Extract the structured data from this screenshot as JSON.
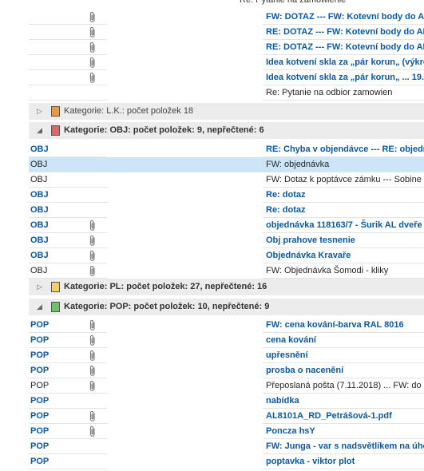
{
  "top_fragment": "Re: Pytanie na zamowienie",
  "top_rows": [
    {
      "subject": "FW: DOTAZ --- FW: Kotevní body do AL",
      "attach": true,
      "unread": true
    },
    {
      "subject": "RE: DOTAZ --- FW: Kotevní body do AL",
      "attach": true,
      "unread": true
    },
    {
      "subject": "RE: DOTAZ --- FW: Kotevní body do AL",
      "attach": true,
      "unread": true
    },
    {
      "subject": "Idea kotvení skla za „pár korun„ (výkre",
      "attach": true,
      "unread": true
    },
    {
      "subject": "Idea kotvení skla za „pár korun„ ... 19.",
      "attach": true,
      "unread": true
    },
    {
      "subject": "Re: Pytanie na odbior zamowien",
      "attach": false,
      "unread": false
    }
  ],
  "groups": {
    "lk": {
      "label": "Kategorie: L.K.: počet položek 18",
      "color": "#f0963c",
      "expanded": false
    },
    "obj": {
      "label": "Kategorie: OBJ: počet položek: 9, nepřečtené: 6",
      "color": "#e06666",
      "expanded": true
    },
    "pl": {
      "label": "Kategorie: PL: počet položek: 27, nepřečtené: 16",
      "color": "#f5d15a",
      "expanded": false
    },
    "pop": {
      "label": "Kategorie: POP: počet položek: 10, nepřečtené: 9",
      "color": "#6cc36c",
      "expanded": true
    }
  },
  "obj_rows": [
    {
      "category": "OBJ",
      "subject": "RE: Chyba v objendávce --- RE: objedn",
      "attach": false,
      "unread": true
    },
    {
      "category": "OBJ",
      "subject": "FW: objednávka",
      "attach": false,
      "unread": false,
      "selected": true
    },
    {
      "category": "OBJ",
      "subject": "FW: Dotaz k poptávce zámku --- Sobine",
      "attach": false,
      "unread": false
    },
    {
      "category": "OBJ",
      "subject": "Re: dotaz",
      "attach": false,
      "unread": true
    },
    {
      "category": "OBJ",
      "subject": "Re: dotaz",
      "attach": false,
      "unread": true
    },
    {
      "category": "OBJ",
      "subject": "objednávka 118163/7 - Šurik AL dveře",
      "attach": true,
      "unread": true
    },
    {
      "category": "OBJ",
      "subject": "Obj prahove tesnenie",
      "attach": true,
      "unread": true
    },
    {
      "category": "OBJ",
      "subject": "Objednávka Kravaře",
      "attach": true,
      "unread": true
    },
    {
      "category": "OBJ",
      "subject": "FW: Objednávka Šomodi - kliky",
      "attach": true,
      "unread": false
    }
  ],
  "pop_rows": [
    {
      "category": "POP",
      "subject": "FW: cena kování-barva RAL 8016",
      "attach": true,
      "unread": true
    },
    {
      "category": "POP",
      "subject": "cena kování",
      "attach": true,
      "unread": true
    },
    {
      "category": "POP",
      "subject": "upřesnění",
      "attach": true,
      "unread": true
    },
    {
      "category": "POP",
      "subject": "prosba o nacenění",
      "attach": true,
      "unread": true
    },
    {
      "category": "POP",
      "subject": "Přeposlaná pošta (7.11.2018) ... FW: do",
      "attach": true,
      "unread": false
    },
    {
      "category": "POP",
      "subject": "nabídka",
      "attach": false,
      "unread": true
    },
    {
      "category": "POP",
      "subject": "AL8101A_RD_Petrášová-1.pdf",
      "attach": true,
      "unread": true
    },
    {
      "category": "POP",
      "subject": "Poncza hsY",
      "attach": true,
      "unread": true
    },
    {
      "category": "POP",
      "subject": "FW: Junga - var s nadsvětlíkem na úhe",
      "attach": false,
      "unread": true
    },
    {
      "category": "POP",
      "subject": "poptavka - viktor plot",
      "attach": false,
      "unread": true
    }
  ],
  "icons": {
    "attachment": "paperclip-icon",
    "expand": "triangle-right-icon",
    "collapse": "triangle-down-icon"
  }
}
